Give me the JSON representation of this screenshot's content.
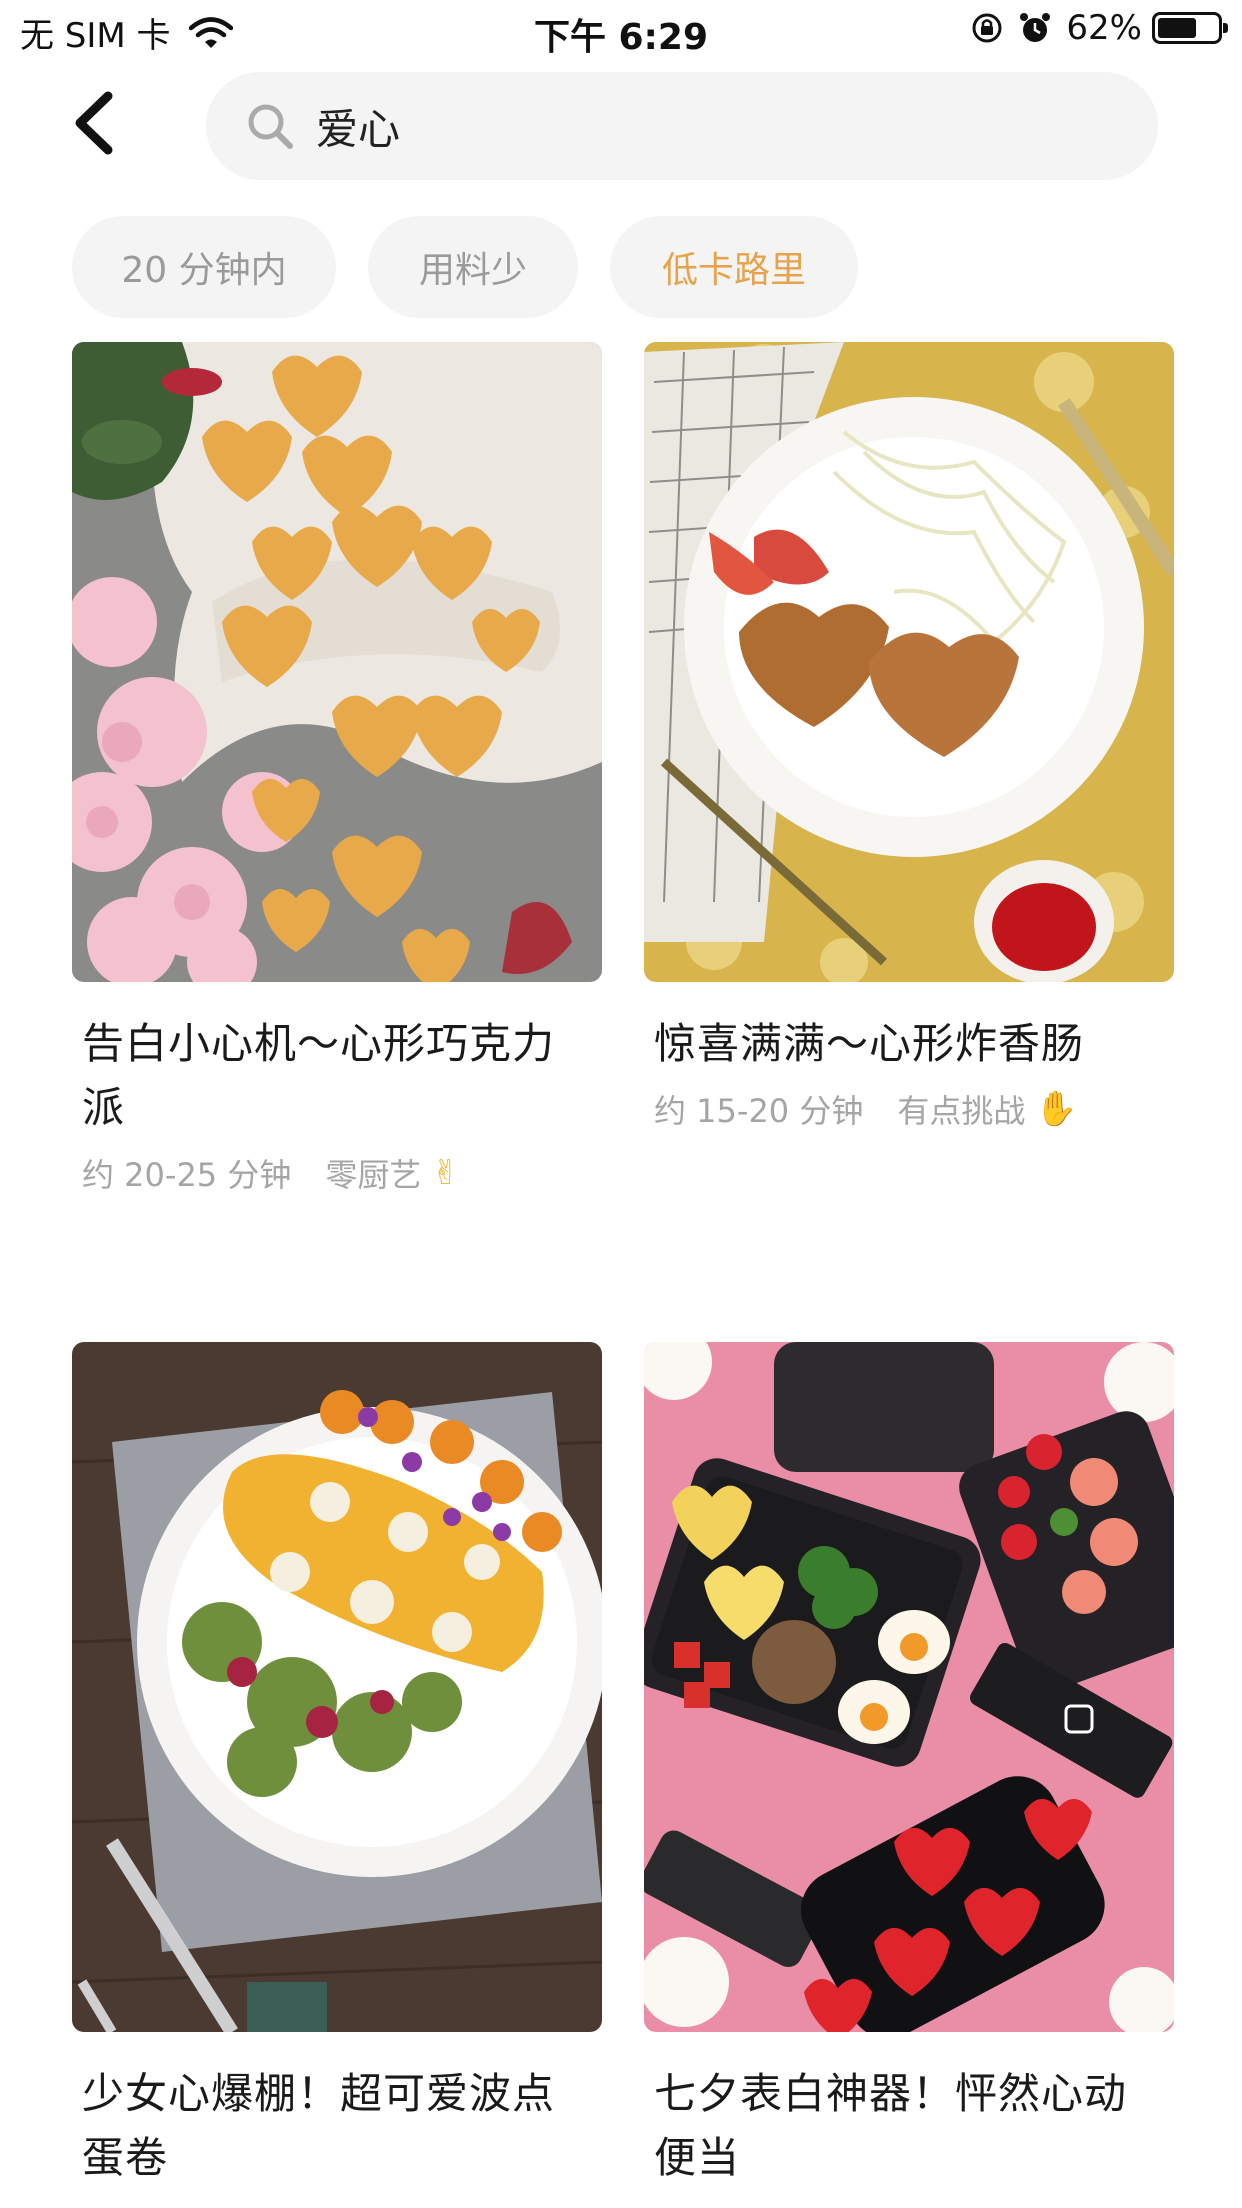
{
  "status_bar": {
    "carrier": "无 SIM 卡",
    "time": "下午 6:29",
    "battery": "62%"
  },
  "search": {
    "query": "爱心"
  },
  "filters": [
    {
      "label": "20 分钟内",
      "selected": false
    },
    {
      "label": "用料少",
      "selected": false
    },
    {
      "label": "低卡路里",
      "selected": true
    }
  ],
  "colors": {
    "accent": "#e6a34b",
    "chip_bg": "#f4f4f4",
    "muted_text": "#a5a5a5"
  },
  "recipes": [
    {
      "title": "告白小心机～心形巧克力派",
      "time": "约 20-25 分钟",
      "difficulty": "零厨艺",
      "emoji": "✌"
    },
    {
      "title": "惊喜满满～心形炸香肠",
      "time": "约 15-20 分钟",
      "difficulty": "有点挑战",
      "emoji": "✋"
    },
    {
      "title": "少女心爆棚！超可爱波点蛋卷",
      "time": "",
      "difficulty": "",
      "emoji": ""
    },
    {
      "title": "七夕表白神器！怦然心动便当",
      "time": "",
      "difficulty": "",
      "emoji": ""
    }
  ]
}
